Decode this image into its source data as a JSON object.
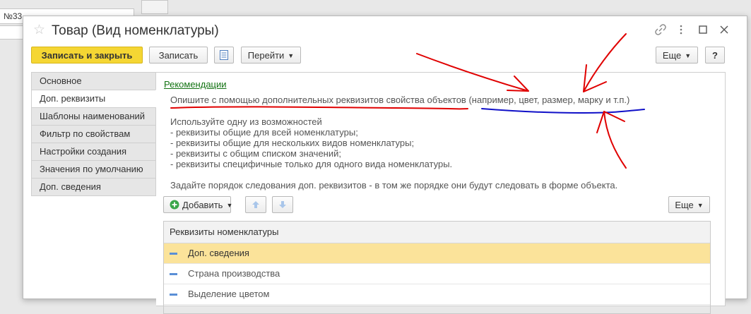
{
  "background": {
    "field_value": "№33"
  },
  "window": {
    "title": "Товар (Вид номенклатуры)",
    "icons": [
      "link-icon",
      "more-vert-icon",
      "maximize-icon",
      "close-icon"
    ]
  },
  "toolbar": {
    "save_close": "Записать и закрыть",
    "save": "Записать",
    "goto": "Перейти",
    "more": "Еще",
    "help": "?"
  },
  "nav": {
    "items": [
      "Основное",
      "Доп. реквизиты",
      "Шаблоны наименований",
      "Фильтр по свойствам",
      "Настройки создания",
      "Значения по умолчанию",
      "Доп. сведения"
    ],
    "active_index": 1
  },
  "content": {
    "recommendations_link": "Рекомендации",
    "hint1": "Опишите с помощью дополнительных реквизитов свойства объектов (например, цвет, размер, марку и т.п.)",
    "hint2": "Используйте одну из возможностей",
    "hint3": "- реквизиты общие для всей номенклатуры;",
    "hint4": "- реквизиты общие для нескольких видов номенклатуры;",
    "hint5": "- реквизиты с общим списком значений;",
    "hint6": "- реквизиты специфичные только для одного вида номенклатуры.",
    "hint7": "Задайте порядок следования доп. реквизитов - в том же порядке они будут следовать в форме объекта.",
    "add_button": "Добавить",
    "more_button": "Еще",
    "grid_header": "Реквизиты номенклатуры",
    "rows": [
      "Доп. сведения",
      "Страна производства",
      "Выделение цветом"
    ]
  },
  "annotation_colors": {
    "red": "#e00000",
    "blue": "#1010c8"
  }
}
